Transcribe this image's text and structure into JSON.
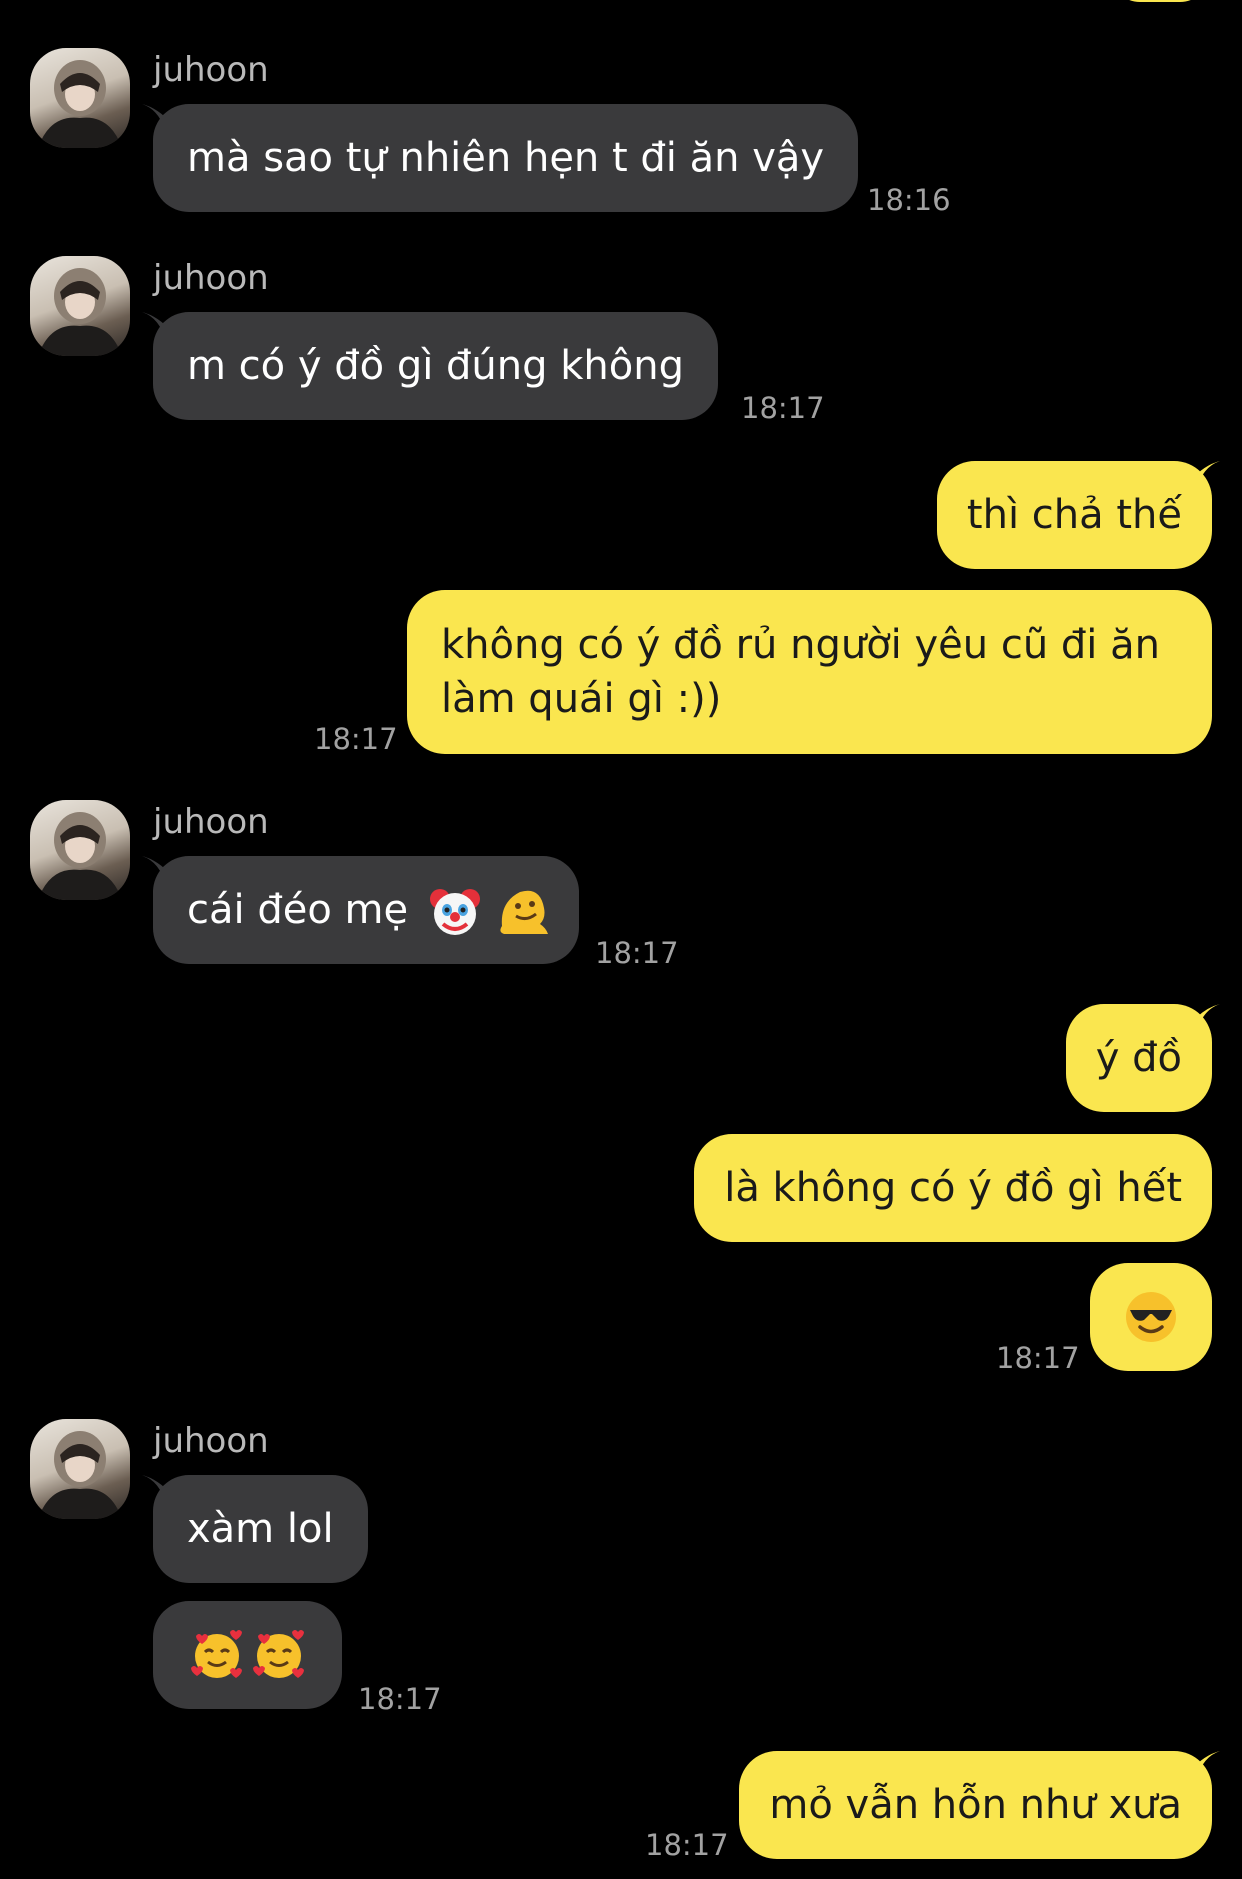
{
  "chat": {
    "messages": [
      {
        "sender": "juhoon",
        "text": "mà sao tự nhiên hẹn t đi ăn vậy",
        "time": "18:16"
      },
      {
        "sender": "juhoon",
        "text": "m có ý đồ gì đúng không",
        "time": "18:17"
      },
      {
        "text": "thì chả thế"
      },
      {
        "text": "không có ý đồ rủ người yêu cũ đi ăn làm quái gì :))",
        "time": "18:17"
      },
      {
        "sender": "juhoon",
        "text": "cái đéo mẹ",
        "emojis": [
          "clown-face-emoji",
          "melting-face-emoji"
        ],
        "time": "18:17"
      },
      {
        "text": "ý đồ"
      },
      {
        "text": "là không có ý đồ gì hết"
      },
      {
        "emojis": [
          "smiling-face-with-sunglasses-emoji"
        ],
        "time": "18:17"
      },
      {
        "sender": "juhoon",
        "text": "xàm lol"
      },
      {
        "sender": "juhoon",
        "emojis": [
          "smiling-face-with-hearts-emoji",
          "smiling-face-with-hearts-emoji"
        ],
        "time": "18:17"
      },
      {
        "text": "mỏ vẫn hỗn như xưa",
        "time": "18:17"
      }
    ]
  },
  "colors": {
    "background": "#000000",
    "received_bubble": "#3a3a3c",
    "sent_bubble": "#fae64f"
  }
}
